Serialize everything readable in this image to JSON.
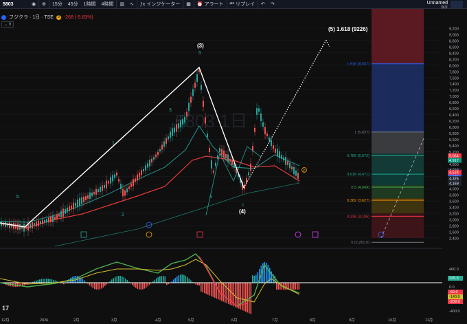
{
  "toolbar": {
    "symbol": "5803",
    "intervals": [
      "15分",
      "45分",
      "1時間",
      "4時間"
    ],
    "indicators_label": "インジケーター",
    "alert_label": "アラート",
    "replay_label": "リプレイ",
    "user_name": "Unnamed",
    "user_sub": "保存"
  },
  "legend": {
    "title": "フジクラ · 1日 · TSE",
    "badge": "D",
    "change": "-268 (-5.83%)",
    "collapse": "9"
  },
  "chart_data": {
    "type": "candlestick",
    "price_axis_labels": [
      "9,200",
      "9,000",
      "8,800",
      "8,600",
      "8,400",
      "8,200",
      "8,000",
      "7,800",
      "7,600",
      "7,400",
      "7,200",
      "7,000",
      "6,800",
      "6,600",
      "6,400",
      "6,200",
      "6,000",
      "5,800",
      "5,600",
      "5,400",
      "5,200",
      "5,000",
      "4,800",
      "4,600",
      "4,400",
      "4,200",
      "4,000",
      "3,800",
      "3,600",
      "3,400",
      "3,200",
      "3,000",
      "2,800",
      "2,600",
      "2,400"
    ],
    "price_tags": [
      {
        "text": "5,064",
        "color": "#f23645"
      },
      {
        "text": "4,917",
        "color": "#089981"
      },
      {
        "text": "4,593",
        "color": "#ffffff"
      },
      {
        "text": "4,524",
        "color": "#f23645"
      },
      {
        "text": "4,375",
        "color": "#2962ff"
      },
      {
        "text": "4,325",
        "color": "#ffffff"
      },
      {
        "text": "4,169",
        "color": "#ffffff"
      }
    ],
    "fib_levels": [
      {
        "label": "1.618 (8,047)",
        "color": "#2962ff"
      },
      {
        "label": "1 (5,837)",
        "color": "#787b86"
      },
      {
        "label": "0.786 (5,072)",
        "color": "#22ab94"
      },
      {
        "label": "0.618 (4,471)",
        "color": "#22ab94"
      },
      {
        "label": "0.5 (4,049)",
        "color": "#4caf50"
      },
      {
        "label": "0.382 (3,627)",
        "color": "#ff9800"
      },
      {
        "label": "0.236 (3,105)",
        "color": "#f23645"
      },
      {
        "label": "0 (2,261.0)",
        "color": "#787b86"
      }
    ],
    "wave_labels": [
      "(3)",
      "5",
      "(4)",
      "c",
      "(5) 1.618 (9226)",
      "3",
      "1",
      "2",
      "a",
      "b",
      "D"
    ],
    "x_axis_labels": [
      "12月",
      "2026",
      "2月",
      "3月",
      "4月",
      "5月",
      "6月",
      "7月",
      "8月",
      "9月",
      "10月",
      "11月"
    ],
    "osc_axis_labels": [
      "400.0",
      "225.6",
      "0.0",
      "-69.0",
      "-140.9",
      "-209.9",
      "-400.0"
    ]
  }
}
